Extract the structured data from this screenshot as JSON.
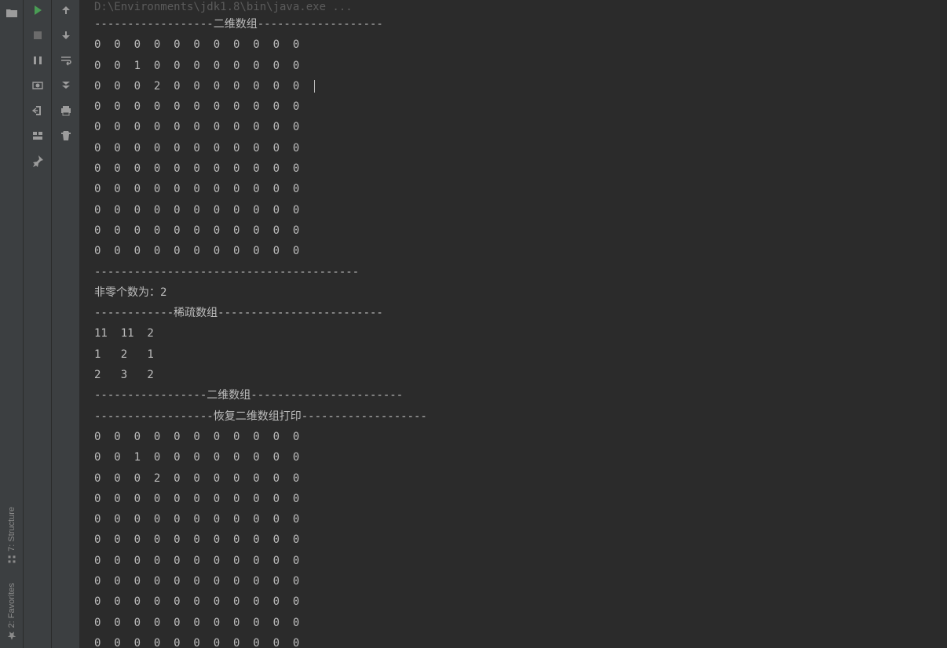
{
  "side_tabs": {
    "structure": "7: Structure",
    "favorites": "2: Favorites"
  },
  "console": {
    "header": "D:\\Environments\\jdk1.8\\bin\\java.exe ...",
    "lines": [
      "------------------二维数组-------------------",
      "0  0  0  0  0  0  0  0  0  0  0  ",
      "0  0  1  0  0  0  0  0  0  0  0  ",
      "0  0  0  2  0  0  0  0  0  0  0  ",
      "0  0  0  0  0  0  0  0  0  0  0  ",
      "0  0  0  0  0  0  0  0  0  0  0  ",
      "0  0  0  0  0  0  0  0  0  0  0  ",
      "0  0  0  0  0  0  0  0  0  0  0  ",
      "0  0  0  0  0  0  0  0  0  0  0  ",
      "0  0  0  0  0  0  0  0  0  0  0  ",
      "0  0  0  0  0  0  0  0  0  0  0  ",
      "0  0  0  0  0  0  0  0  0  0  0  ",
      "----------------------------------------",
      "非零个数为：2",
      "------------稀疏数组-------------------------",
      "11  11  2  ",
      "1   2   1   ",
      "2   3   2   ",
      "-----------------二维数组-----------------------",
      "------------------恢复二维数组打印-------------------",
      "0  0  0  0  0  0  0  0  0  0  0  ",
      "0  0  1  0  0  0  0  0  0  0  0  ",
      "0  0  0  2  0  0  0  0  0  0  0  ",
      "0  0  0  0  0  0  0  0  0  0  0  ",
      "0  0  0  0  0  0  0  0  0  0  0  ",
      "0  0  0  0  0  0  0  0  0  0  0  ",
      "0  0  0  0  0  0  0  0  0  0  0  ",
      "0  0  0  0  0  0  0  0  0  0  0  ",
      "0  0  0  0  0  0  0  0  0  0  0  ",
      "0  0  0  0  0  0  0  0  0  0  0  ",
      "0  0  0  0  0  0  0  0  0  0  0  "
    ]
  },
  "caret_line_index": 3
}
